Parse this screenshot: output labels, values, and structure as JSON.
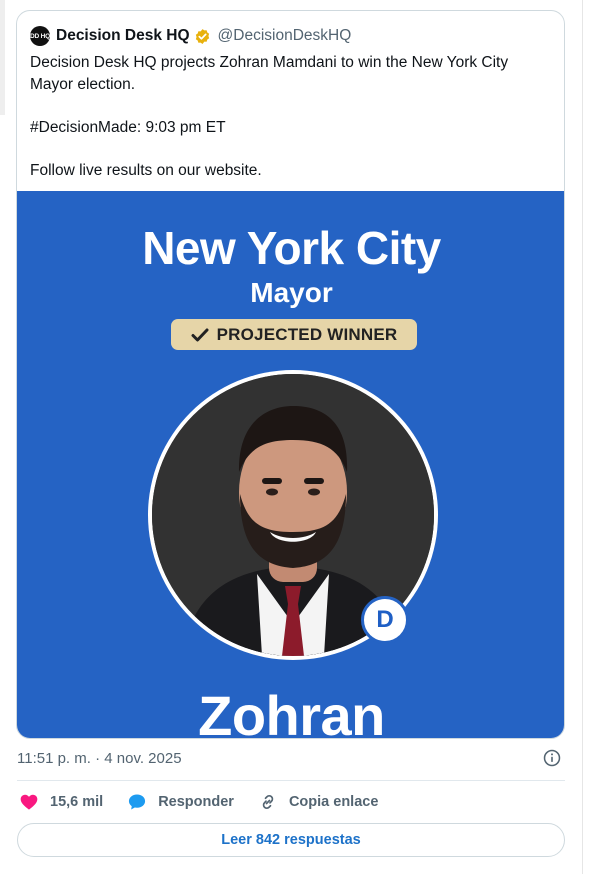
{
  "tweet": {
    "author_name": "Decision Desk HQ",
    "handle": "@DecisionDeskHQ",
    "logo_text": "DD HQ",
    "verified_color": "#e8b10d",
    "text_lines": [
      "Decision Desk HQ projects Zohran Mamdani to win the New York City Mayor election.",
      "#DecisionMade: 9:03 pm ET",
      "Follow live results on our website."
    ]
  },
  "media": {
    "background_color": "#2563c4",
    "title": "New York City",
    "subtitle": "Mayor",
    "badge": "PROJECTED WINNER",
    "party_badge": "D",
    "candidate_name": "Zohran"
  },
  "meta": {
    "timestamp": "11:51 p. m. · 4 nov. 2025"
  },
  "actions": {
    "likes": {
      "icon": "heart-icon",
      "label": "15,6 mil",
      "color": "#f91880"
    },
    "reply": {
      "icon": "reply-bubble-icon",
      "label": "Responder",
      "color": "#1d9bf0"
    },
    "copy_link": {
      "icon": "link-icon",
      "label": "Copia enlace"
    }
  },
  "read_replies": "Leer 842 respuestas"
}
